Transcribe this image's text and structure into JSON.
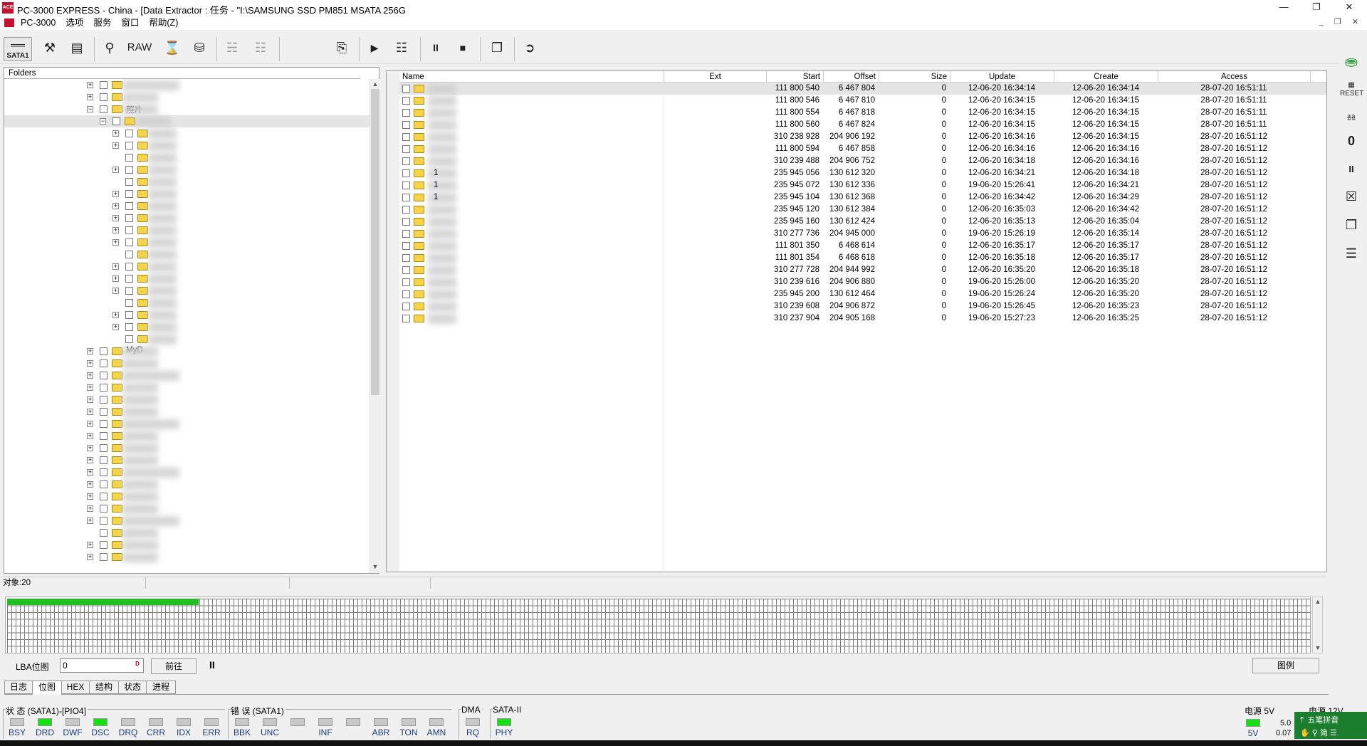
{
  "window": {
    "title": "PC-3000 EXPRESS - China - [Data Extractor : 任务 - \"I:\\SAMSUNG SSD PM851 MSATA 256G"
  },
  "menu": {
    "items": [
      "PC-3000",
      "选项",
      "服务",
      "窗口",
      "帮助(Z)"
    ]
  },
  "toolbar": {
    "sata_label": "SATA1",
    "raw_label": "RAW"
  },
  "tree": {
    "header": "Folders",
    "rows": [
      {
        "depth": 0,
        "exp": "+",
        "label": "",
        "sel": false
      },
      {
        "depth": 0,
        "exp": "+",
        "label": "",
        "sel": false
      },
      {
        "depth": 0,
        "exp": "-",
        "label": "照片",
        "sel": false
      },
      {
        "depth": 1,
        "exp": "-",
        "label": "",
        "sel": true
      },
      {
        "depth": 2,
        "exp": "+",
        "label": "",
        "sel": false
      },
      {
        "depth": 2,
        "exp": "+",
        "label": "",
        "sel": false
      },
      {
        "depth": 2,
        "exp": "",
        "label": "",
        "sel": false
      },
      {
        "depth": 2,
        "exp": "+",
        "label": "",
        "sel": false
      },
      {
        "depth": 2,
        "exp": "",
        "label": "",
        "sel": false
      },
      {
        "depth": 2,
        "exp": "+",
        "label": "",
        "sel": false
      },
      {
        "depth": 2,
        "exp": "+",
        "label": "",
        "sel": false
      },
      {
        "depth": 2,
        "exp": "+",
        "label": "",
        "sel": false
      },
      {
        "depth": 2,
        "exp": "+",
        "label": "",
        "sel": false
      },
      {
        "depth": 2,
        "exp": "+",
        "label": "",
        "sel": false
      },
      {
        "depth": 2,
        "exp": "",
        "label": "",
        "sel": false
      },
      {
        "depth": 2,
        "exp": "+",
        "label": "",
        "sel": false
      },
      {
        "depth": 2,
        "exp": "+",
        "label": "",
        "sel": false
      },
      {
        "depth": 2,
        "exp": "+",
        "label": "",
        "sel": false
      },
      {
        "depth": 2,
        "exp": "",
        "label": "",
        "sel": false
      },
      {
        "depth": 2,
        "exp": "+",
        "label": "",
        "sel": false
      },
      {
        "depth": 2,
        "exp": "+",
        "label": "",
        "sel": false
      },
      {
        "depth": 2,
        "exp": "",
        "label": "",
        "sel": false
      },
      {
        "depth": 0,
        "exp": "+",
        "label": "MyD",
        "sel": false
      },
      {
        "depth": 0,
        "exp": "+",
        "label": "",
        "sel": false
      },
      {
        "depth": 0,
        "exp": "+",
        "label": "",
        "sel": false
      },
      {
        "depth": 0,
        "exp": "+",
        "label": "",
        "sel": false
      },
      {
        "depth": 0,
        "exp": "+",
        "label": "",
        "sel": false
      },
      {
        "depth": 0,
        "exp": "+",
        "label": "",
        "sel": false
      },
      {
        "depth": 0,
        "exp": "+",
        "label": "",
        "sel": false
      },
      {
        "depth": 0,
        "exp": "+",
        "label": "",
        "sel": false
      },
      {
        "depth": 0,
        "exp": "+",
        "label": "",
        "sel": false
      },
      {
        "depth": 0,
        "exp": "+",
        "label": "",
        "sel": false
      },
      {
        "depth": 0,
        "exp": "+",
        "label": "",
        "sel": false
      },
      {
        "depth": 0,
        "exp": "+",
        "label": "",
        "sel": false
      },
      {
        "depth": 0,
        "exp": "+",
        "label": "",
        "sel": false
      },
      {
        "depth": 0,
        "exp": "+",
        "label": "",
        "sel": false
      },
      {
        "depth": 0,
        "exp": "+",
        "label": "",
        "sel": false
      },
      {
        "depth": 0,
        "exp": "",
        "label": "",
        "sel": false
      },
      {
        "depth": 0,
        "exp": "+",
        "label": "",
        "sel": false
      },
      {
        "depth": 0,
        "exp": "+",
        "label": "",
        "sel": false
      }
    ]
  },
  "list": {
    "columns": [
      "Name",
      "Ext",
      "Start",
      "Offset",
      "Size",
      "Update",
      "Create",
      "Access"
    ],
    "rows": [
      {
        "name": "",
        "ext": "",
        "start": "111 800 540",
        "offset": "6 467 804",
        "size": "0",
        "update": "12-06-20 16:34:14",
        "create": "12-06-20 16:34:14",
        "access": "28-07-20 16:51:11"
      },
      {
        "name": "",
        "ext": "",
        "start": "111 800 546",
        "offset": "6 467 810",
        "size": "0",
        "update": "12-06-20 16:34:15",
        "create": "12-06-20 16:34:15",
        "access": "28-07-20 16:51:11"
      },
      {
        "name": "",
        "ext": "",
        "start": "111 800 554",
        "offset": "6 467 818",
        "size": "0",
        "update": "12-06-20 16:34:15",
        "create": "12-06-20 16:34:15",
        "access": "28-07-20 16:51:11"
      },
      {
        "name": "",
        "ext": "",
        "start": "111 800 560",
        "offset": "6 467 824",
        "size": "0",
        "update": "12-06-20 16:34:15",
        "create": "12-06-20 16:34:15",
        "access": "28-07-20 16:51:11"
      },
      {
        "name": "",
        "ext": "",
        "start": "310 238 928",
        "offset": "204 906 192",
        "size": "0",
        "update": "12-06-20 16:34:16",
        "create": "12-06-20 16:34:15",
        "access": "28-07-20 16:51:12"
      },
      {
        "name": "",
        "ext": "",
        "start": "111 800 594",
        "offset": "6 467 858",
        "size": "0",
        "update": "12-06-20 16:34:16",
        "create": "12-06-20 16:34:16",
        "access": "28-07-20 16:51:12"
      },
      {
        "name": "",
        "ext": "",
        "start": "310 239 488",
        "offset": "204 906 752",
        "size": "0",
        "update": "12-06-20 16:34:18",
        "create": "12-06-20 16:34:16",
        "access": "28-07-20 16:51:12"
      },
      {
        "name": "1",
        "ext": "",
        "start": "235 945 056",
        "offset": "130 612 320",
        "size": "0",
        "update": "12-06-20 16:34:21",
        "create": "12-06-20 16:34:18",
        "access": "28-07-20 16:51:12"
      },
      {
        "name": "1",
        "ext": "",
        "start": "235 945 072",
        "offset": "130 612 336",
        "size": "0",
        "update": "19-06-20 15:26:41",
        "create": "12-06-20 16:34:21",
        "access": "28-07-20 16:51:12"
      },
      {
        "name": "1",
        "ext": "",
        "start": "235 945 104",
        "offset": "130 612 368",
        "size": "0",
        "update": "12-06-20 16:34:42",
        "create": "12-06-20 16:34:29",
        "access": "28-07-20 16:51:12"
      },
      {
        "name": "",
        "ext": "",
        "start": "235 945 120",
        "offset": "130 612 384",
        "size": "0",
        "update": "12-06-20 16:35:03",
        "create": "12-06-20 16:34:42",
        "access": "28-07-20 16:51:12"
      },
      {
        "name": "",
        "ext": "",
        "start": "235 945 160",
        "offset": "130 612 424",
        "size": "0",
        "update": "12-06-20 16:35:13",
        "create": "12-06-20 16:35:04",
        "access": "28-07-20 16:51:12"
      },
      {
        "name": "",
        "ext": "",
        "start": "310 277 736",
        "offset": "204 945 000",
        "size": "0",
        "update": "19-06-20 15:26:19",
        "create": "12-06-20 16:35:14",
        "access": "28-07-20 16:51:12"
      },
      {
        "name": "",
        "ext": "",
        "start": "111 801 350",
        "offset": "6 468 614",
        "size": "0",
        "update": "12-06-20 16:35:17",
        "create": "12-06-20 16:35:17",
        "access": "28-07-20 16:51:12"
      },
      {
        "name": "",
        "ext": "",
        "start": "111 801 354",
        "offset": "6 468 618",
        "size": "0",
        "update": "12-06-20 16:35:18",
        "create": "12-06-20 16:35:17",
        "access": "28-07-20 16:51:12"
      },
      {
        "name": "",
        "ext": "",
        "start": "310 277 728",
        "offset": "204 944 992",
        "size": "0",
        "update": "12-06-20 16:35:20",
        "create": "12-06-20 16:35:18",
        "access": "28-07-20 16:51:12"
      },
      {
        "name": "",
        "ext": "",
        "start": "310 239 616",
        "offset": "204 906 880",
        "size": "0",
        "update": "19-06-20 15:26:00",
        "create": "12-06-20 16:35:20",
        "access": "28-07-20 16:51:12"
      },
      {
        "name": "",
        "ext": "",
        "start": "235 945 200",
        "offset": "130 612 464",
        "size": "0",
        "update": "19-06-20 15:26:24",
        "create": "12-06-20 16:35:20",
        "access": "28-07-20 16:51:12"
      },
      {
        "name": "",
        "ext": "",
        "start": "310 239 608",
        "offset": "204 906 872",
        "size": "0",
        "update": "19-06-20 15:26:45",
        "create": "12-06-20 16:35:23",
        "access": "28-07-20 16:51:12"
      },
      {
        "name": "",
        "ext": "",
        "start": "310 237 904",
        "offset": "204 905 168",
        "size": "0",
        "update": "19-06-20 15:27:23",
        "create": "12-06-20 16:35:25",
        "access": "28-07-20 16:51:12"
      }
    ]
  },
  "statusbar": {
    "object_count": "对象:20"
  },
  "lba": {
    "label": "LBA位图",
    "input_value": "0",
    "input_btn": "D",
    "goto_label": "前往",
    "pause": "II",
    "legend_label": "图例",
    "filled_fraction": 0.147
  },
  "tabs": [
    "日志",
    "位图",
    "HEX",
    "结构",
    "状态",
    "进程"
  ],
  "active_tab": 1,
  "indicators": {
    "status_title": "状 态 (SATA1)-[PIO4]",
    "status": [
      {
        "label": "BSY",
        "on": false
      },
      {
        "label": "DRD",
        "on": true
      },
      {
        "label": "DWF",
        "on": false
      },
      {
        "label": "DSC",
        "on": true
      },
      {
        "label": "DRQ",
        "on": false
      },
      {
        "label": "CRR",
        "on": false
      },
      {
        "label": "IDX",
        "on": false
      },
      {
        "label": "ERR",
        "on": false
      }
    ],
    "error_title": "错 误 (SATA1)",
    "errors": [
      {
        "label": "BBK",
        "on": false
      },
      {
        "label": "UNC",
        "on": false
      },
      {
        "label": "",
        "on": false
      },
      {
        "label": "INF",
        "on": false
      },
      {
        "label": "",
        "on": false
      },
      {
        "label": "ABR",
        "on": false
      },
      {
        "label": "TON",
        "on": false
      },
      {
        "label": "AMN",
        "on": false
      }
    ],
    "dma_title": "DMA",
    "dma": [
      {
        "label": "RQ",
        "on": false
      }
    ],
    "sata_title": "SATA-II",
    "sata": [
      {
        "label": "PHY",
        "on": true
      }
    ]
  },
  "power": {
    "title_5v": "电源 5V",
    "title_12v": "电源 12V",
    "led_label": "5V",
    "voltage": "5.0",
    "current": "0.07"
  },
  "ime": {
    "label": "五笔拼音",
    "lang": "简"
  },
  "colors": {
    "led_on": "#14e014",
    "bitmap_filled": "#1fc01f",
    "brand_red": "#c8102e"
  }
}
